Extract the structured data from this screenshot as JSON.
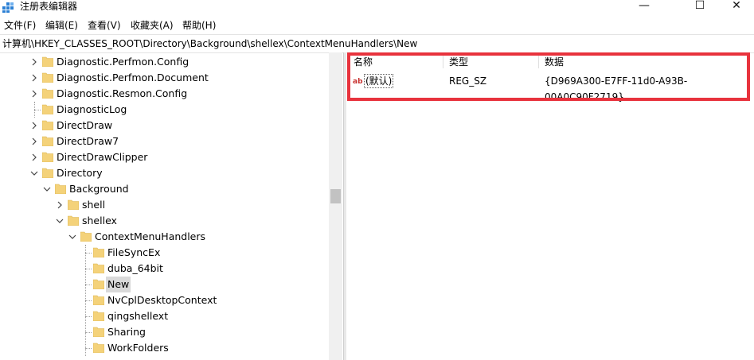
{
  "window": {
    "title": "注册表编辑器",
    "minimize": "—",
    "maximize": "☐",
    "close": "✕"
  },
  "menu": [
    "文件(F)",
    "编辑(E)",
    "查看(V)",
    "收藏夹(A)",
    "帮助(H)"
  ],
  "address": "计算机\\HKEY_CLASSES_ROOT\\Directory\\Background\\shellex\\ContextMenuHandlers\\New",
  "tree": [
    {
      "label": "Diagnostic.Perfmon.Config",
      "expander": "collapsed"
    },
    {
      "label": "Diagnostic.Perfmon.Document",
      "expander": "collapsed"
    },
    {
      "label": "Diagnostic.Resmon.Config",
      "expander": "collapsed"
    },
    {
      "label": "DiagnosticLog",
      "expander": "none"
    },
    {
      "label": "DirectDraw",
      "expander": "collapsed"
    },
    {
      "label": "DirectDraw7",
      "expander": "collapsed"
    },
    {
      "label": "DirectDrawClipper",
      "expander": "collapsed"
    },
    {
      "label": "Directory",
      "expander": "expanded"
    },
    {
      "label": "Background",
      "expander": "expanded"
    },
    {
      "label": "shell",
      "expander": "collapsed"
    },
    {
      "label": "shellex",
      "expander": "expanded"
    },
    {
      "label": "ContextMenuHandlers",
      "expander": "expanded"
    },
    {
      "label": "FileSyncEx",
      "expander": "none"
    },
    {
      "label": "duba_64bit",
      "expander": "none"
    },
    {
      "label": "New",
      "expander": "none",
      "selected": true
    },
    {
      "label": "NvCplDesktopContext",
      "expander": "none"
    },
    {
      "label": "qingshellext",
      "expander": "none"
    },
    {
      "label": "Sharing",
      "expander": "none"
    },
    {
      "label": "WorkFolders",
      "expander": "none"
    }
  ],
  "list": {
    "headers": {
      "name": "名称",
      "type": "类型",
      "data": "数据"
    },
    "rows": [
      {
        "icon": "string-value-icon",
        "name": "(默认)",
        "type": "REG_SZ",
        "data": "{D969A300-E7FF-11d0-A93B-00A0C90F2719}"
      }
    ]
  },
  "colors": {
    "highlight": "#e8333d",
    "folder": "#f4d27a",
    "selection": "#d9d9d9"
  }
}
